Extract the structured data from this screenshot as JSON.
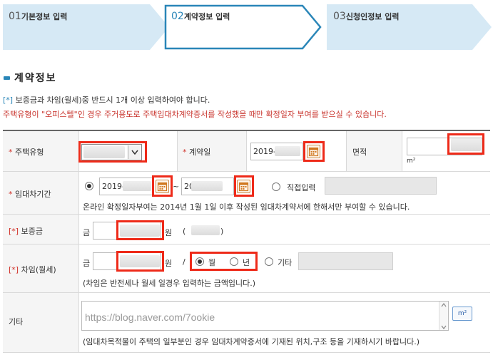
{
  "steps": [
    {
      "num": "01",
      "label": "기본정보 입력",
      "active": false
    },
    {
      "num": "02",
      "label": "계약정보 입력",
      "active": true
    },
    {
      "num": "03",
      "label": "신청인정보 입력",
      "active": false
    }
  ],
  "section_title": "계약정보",
  "notices": {
    "mark": "[*]",
    "line1": " 보증금과 차임(월세)중 반드시 1개 이상 입력하여야 합니다.",
    "line2": "주택유형이 \"오피스텔\"인 경우 주거용도로 주택임대차계약증서를 작성했을 때만 확정일자 부여를 받으실 수 있습니다."
  },
  "form": {
    "housing_type": {
      "label": "주택유형",
      "req": "*"
    },
    "contract_date": {
      "label": "계약일",
      "req": "*",
      "value": "2019-"
    },
    "area": {
      "label": "면적",
      "unit": "m²"
    },
    "lease_period": {
      "label": "임대차기간",
      "req": "*",
      "start": "2019-",
      "tilde": "~",
      "end": "20",
      "direct_label": "직접입력",
      "note": "온라인 확정일자부여는 2014년 1월 1일 이후 작성된 임대차계약서에 한해서만 부여할 수 있습니다."
    },
    "deposit": {
      "label": "보증금",
      "req": "[*]",
      "prefix": "금",
      "suffix": "원",
      "paren_open": "(",
      "paren_close": ")"
    },
    "rent": {
      "label": "차임(월세)",
      "req": "[*]",
      "prefix": "금",
      "suffix": "원",
      "slash": "/",
      "opt_month": "월",
      "opt_year": "년",
      "opt_other": "기타",
      "note": "(차임은 반전세나 월세 일경우 입력하는 금액입니다.)"
    },
    "etc": {
      "label": "기타",
      "placeholder": "https://blog.naver.com/7ookie",
      "unit_button": "m²",
      "note": "(임대차목적물이 주택의 일부분인 경우 임대차계약증서에 기재된 위치,구조 등을 기재하시기 바랍니다.)"
    }
  },
  "colors": {
    "accent": "#2a86b8",
    "required": "#d1322a",
    "highlight_box": "#ee2a19",
    "step_fill": "#d6e9f5"
  }
}
